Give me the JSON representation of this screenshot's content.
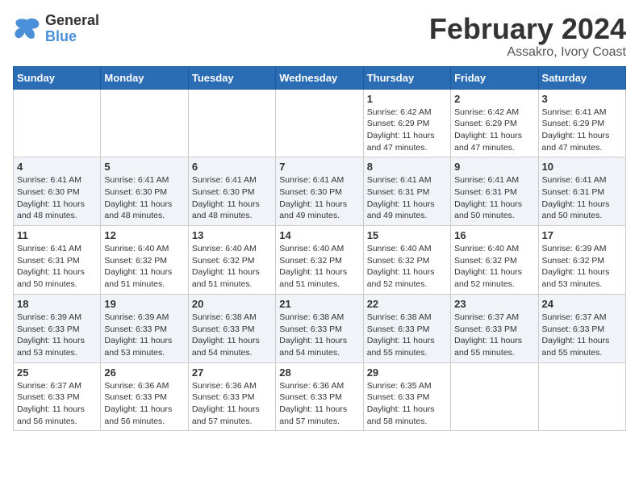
{
  "header": {
    "logo": {
      "line1": "General",
      "line2": "Blue"
    },
    "title": "February 2024",
    "subtitle": "Assakro, Ivory Coast"
  },
  "days_of_week": [
    "Sunday",
    "Monday",
    "Tuesday",
    "Wednesday",
    "Thursday",
    "Friday",
    "Saturday"
  ],
  "weeks": [
    [
      {
        "day": "",
        "info": ""
      },
      {
        "day": "",
        "info": ""
      },
      {
        "day": "",
        "info": ""
      },
      {
        "day": "",
        "info": ""
      },
      {
        "day": "1",
        "info": "Sunrise: 6:42 AM\nSunset: 6:29 PM\nDaylight: 11 hours\nand 47 minutes."
      },
      {
        "day": "2",
        "info": "Sunrise: 6:42 AM\nSunset: 6:29 PM\nDaylight: 11 hours\nand 47 minutes."
      },
      {
        "day": "3",
        "info": "Sunrise: 6:41 AM\nSunset: 6:29 PM\nDaylight: 11 hours\nand 47 minutes."
      }
    ],
    [
      {
        "day": "4",
        "info": "Sunrise: 6:41 AM\nSunset: 6:30 PM\nDaylight: 11 hours\nand 48 minutes."
      },
      {
        "day": "5",
        "info": "Sunrise: 6:41 AM\nSunset: 6:30 PM\nDaylight: 11 hours\nand 48 minutes."
      },
      {
        "day": "6",
        "info": "Sunrise: 6:41 AM\nSunset: 6:30 PM\nDaylight: 11 hours\nand 48 minutes."
      },
      {
        "day": "7",
        "info": "Sunrise: 6:41 AM\nSunset: 6:30 PM\nDaylight: 11 hours\nand 49 minutes."
      },
      {
        "day": "8",
        "info": "Sunrise: 6:41 AM\nSunset: 6:31 PM\nDaylight: 11 hours\nand 49 minutes."
      },
      {
        "day": "9",
        "info": "Sunrise: 6:41 AM\nSunset: 6:31 PM\nDaylight: 11 hours\nand 50 minutes."
      },
      {
        "day": "10",
        "info": "Sunrise: 6:41 AM\nSunset: 6:31 PM\nDaylight: 11 hours\nand 50 minutes."
      }
    ],
    [
      {
        "day": "11",
        "info": "Sunrise: 6:41 AM\nSunset: 6:31 PM\nDaylight: 11 hours\nand 50 minutes."
      },
      {
        "day": "12",
        "info": "Sunrise: 6:40 AM\nSunset: 6:32 PM\nDaylight: 11 hours\nand 51 minutes."
      },
      {
        "day": "13",
        "info": "Sunrise: 6:40 AM\nSunset: 6:32 PM\nDaylight: 11 hours\nand 51 minutes."
      },
      {
        "day": "14",
        "info": "Sunrise: 6:40 AM\nSunset: 6:32 PM\nDaylight: 11 hours\nand 51 minutes."
      },
      {
        "day": "15",
        "info": "Sunrise: 6:40 AM\nSunset: 6:32 PM\nDaylight: 11 hours\nand 52 minutes."
      },
      {
        "day": "16",
        "info": "Sunrise: 6:40 AM\nSunset: 6:32 PM\nDaylight: 11 hours\nand 52 minutes."
      },
      {
        "day": "17",
        "info": "Sunrise: 6:39 AM\nSunset: 6:32 PM\nDaylight: 11 hours\nand 53 minutes."
      }
    ],
    [
      {
        "day": "18",
        "info": "Sunrise: 6:39 AM\nSunset: 6:33 PM\nDaylight: 11 hours\nand 53 minutes."
      },
      {
        "day": "19",
        "info": "Sunrise: 6:39 AM\nSunset: 6:33 PM\nDaylight: 11 hours\nand 53 minutes."
      },
      {
        "day": "20",
        "info": "Sunrise: 6:38 AM\nSunset: 6:33 PM\nDaylight: 11 hours\nand 54 minutes."
      },
      {
        "day": "21",
        "info": "Sunrise: 6:38 AM\nSunset: 6:33 PM\nDaylight: 11 hours\nand 54 minutes."
      },
      {
        "day": "22",
        "info": "Sunrise: 6:38 AM\nSunset: 6:33 PM\nDaylight: 11 hours\nand 55 minutes."
      },
      {
        "day": "23",
        "info": "Sunrise: 6:37 AM\nSunset: 6:33 PM\nDaylight: 11 hours\nand 55 minutes."
      },
      {
        "day": "24",
        "info": "Sunrise: 6:37 AM\nSunset: 6:33 PM\nDaylight: 11 hours\nand 55 minutes."
      }
    ],
    [
      {
        "day": "25",
        "info": "Sunrise: 6:37 AM\nSunset: 6:33 PM\nDaylight: 11 hours\nand 56 minutes."
      },
      {
        "day": "26",
        "info": "Sunrise: 6:36 AM\nSunset: 6:33 PM\nDaylight: 11 hours\nand 56 minutes."
      },
      {
        "day": "27",
        "info": "Sunrise: 6:36 AM\nSunset: 6:33 PM\nDaylight: 11 hours\nand 57 minutes."
      },
      {
        "day": "28",
        "info": "Sunrise: 6:36 AM\nSunset: 6:33 PM\nDaylight: 11 hours\nand 57 minutes."
      },
      {
        "day": "29",
        "info": "Sunrise: 6:35 AM\nSunset: 6:33 PM\nDaylight: 11 hours\nand 58 minutes."
      },
      {
        "day": "",
        "info": ""
      },
      {
        "day": "",
        "info": ""
      }
    ]
  ]
}
